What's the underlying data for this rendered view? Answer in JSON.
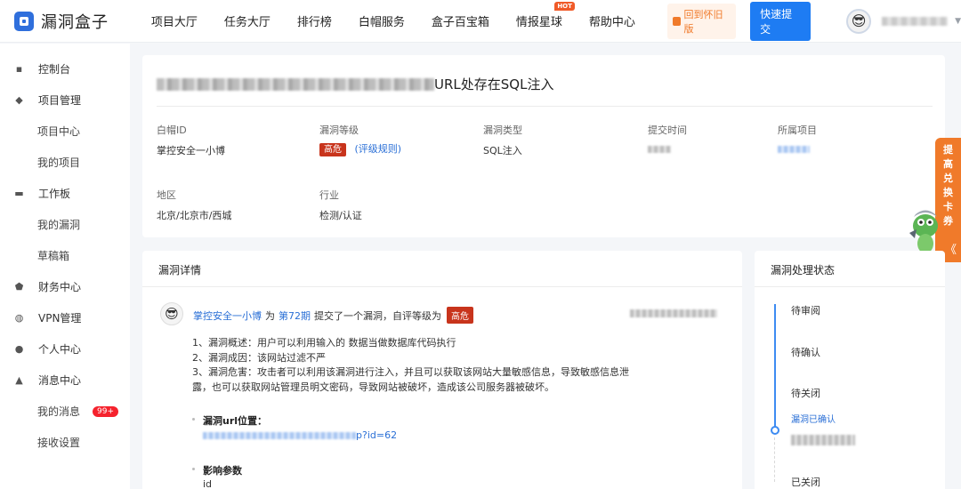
{
  "header": {
    "logo_text": "漏洞盒子",
    "nav": [
      "项目大厅",
      "任务大厅",
      "排行榜",
      "白帽服务",
      "盒子百宝箱",
      "情报星球",
      "帮助中心"
    ],
    "hot_badge": "HOT",
    "old_version": "回到怀旧版",
    "quick_submit": "快速提交"
  },
  "sidebar": {
    "items": [
      {
        "label": "控制台",
        "icon": "dashboard-icon",
        "group": true
      },
      {
        "label": "项目管理",
        "icon": "layers-icon",
        "group": true
      },
      {
        "label": "项目中心",
        "group": false
      },
      {
        "label": "我的项目",
        "group": false
      },
      {
        "label": "工作板",
        "icon": "monitor-icon",
        "group": true
      },
      {
        "label": "我的漏洞",
        "group": false
      },
      {
        "label": "草稿箱",
        "group": false
      },
      {
        "label": "财务中心",
        "icon": "shield-icon",
        "group": true
      },
      {
        "label": "VPN管理",
        "icon": "globe-icon",
        "group": true
      },
      {
        "label": "个人中心",
        "icon": "user-icon",
        "group": true
      },
      {
        "label": "消息中心",
        "icon": "bell-icon",
        "group": true
      },
      {
        "label": "我的消息",
        "group": false
      },
      {
        "label": "接收设置",
        "group": false
      }
    ],
    "message_badge": "99+"
  },
  "vuln": {
    "title_suffix": "URL处存在SQL注入",
    "fields": {
      "whitehat_label": "白帽ID",
      "whitehat_value": "掌控安全一小博",
      "level_label": "漏洞等级",
      "level_value": "高危",
      "rating_link": "(评级规则)",
      "type_label": "漏洞类型",
      "type_value": "SQL注入",
      "time_label": "提交时间",
      "project_label": "所属项目",
      "region_label": "地区",
      "region_value": "北京/北京市/西城",
      "industry_label": "行业",
      "industry_value": "检测/认证"
    }
  },
  "promo": {
    "chars": [
      "提",
      "高",
      "兑",
      "换",
      "卡",
      "券"
    ],
    "arrow": "《"
  },
  "detail": {
    "heading": "漏洞详情",
    "submitter": "掌控安全一小博",
    "to": "为",
    "period": "第72期",
    "submitted": "提交了一个漏洞，自评等级为",
    "level": "高危",
    "line1": "1、漏洞概述：用户可以利用输入的 数据当做数据库代码执行",
    "line2": "2、漏洞成因：该网站过滤不严",
    "line3": "3、漏洞危害：攻击者可以利用该漏洞进行注入，并且可以获取该网站大量敏感信息，导致敏感信息泄",
    "line4": "露，也可以获取网站管理员明文密码，导致网站被破坏，造成该公司服务器被破坏。",
    "url_label": "漏洞url位置：",
    "url_tail": "p?id=62",
    "param_label": "影响参数",
    "param_value": "id"
  },
  "status": {
    "heading": "漏洞处理状态",
    "steps": [
      "待审阅",
      "待确认",
      "待关闭",
      "漏洞已确认",
      "已关闭"
    ]
  }
}
